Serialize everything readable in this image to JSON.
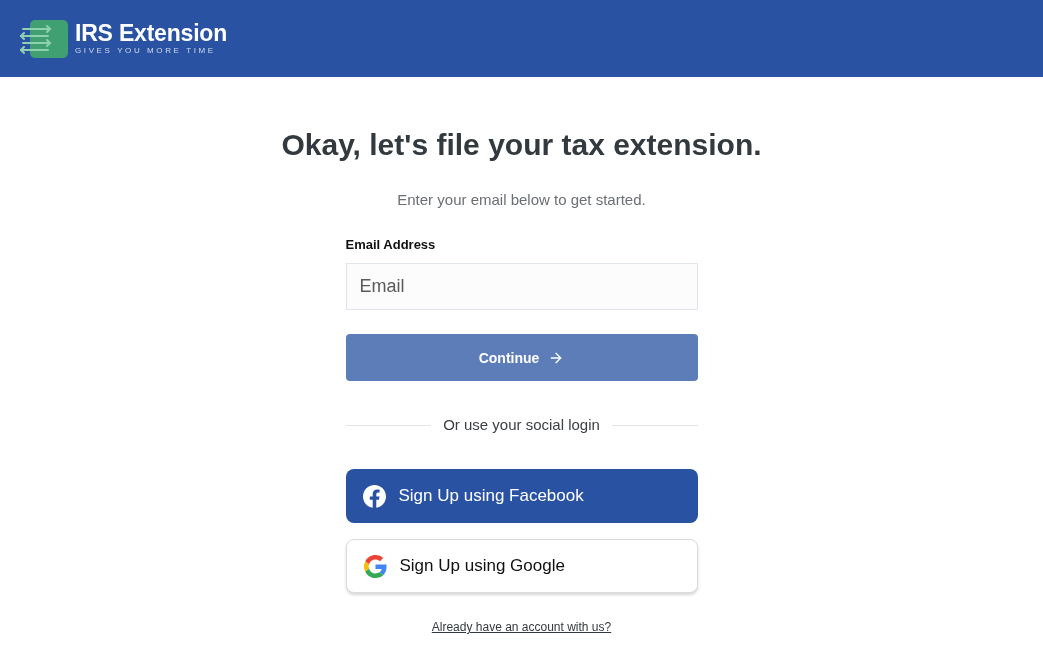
{
  "header": {
    "brand": {
      "name": "IRS Extension",
      "tagline": "GIVES YOU MORE TIME"
    }
  },
  "heading": "Okay, let's file your tax extension.",
  "subheading": "Enter your email below to get started.",
  "form": {
    "email_field": {
      "label": "Email Address",
      "placeholder": "Email"
    },
    "continue_button": {
      "label": "Continue",
      "disabled": true
    }
  },
  "divider": "Or use your social login",
  "social_buttons": [
    {
      "kind": "facebook",
      "label": "Sign Up using Facebook"
    },
    {
      "kind": "google",
      "label": "Sign Up using Google"
    }
  ],
  "signin_link": "Already have an account with us?"
}
